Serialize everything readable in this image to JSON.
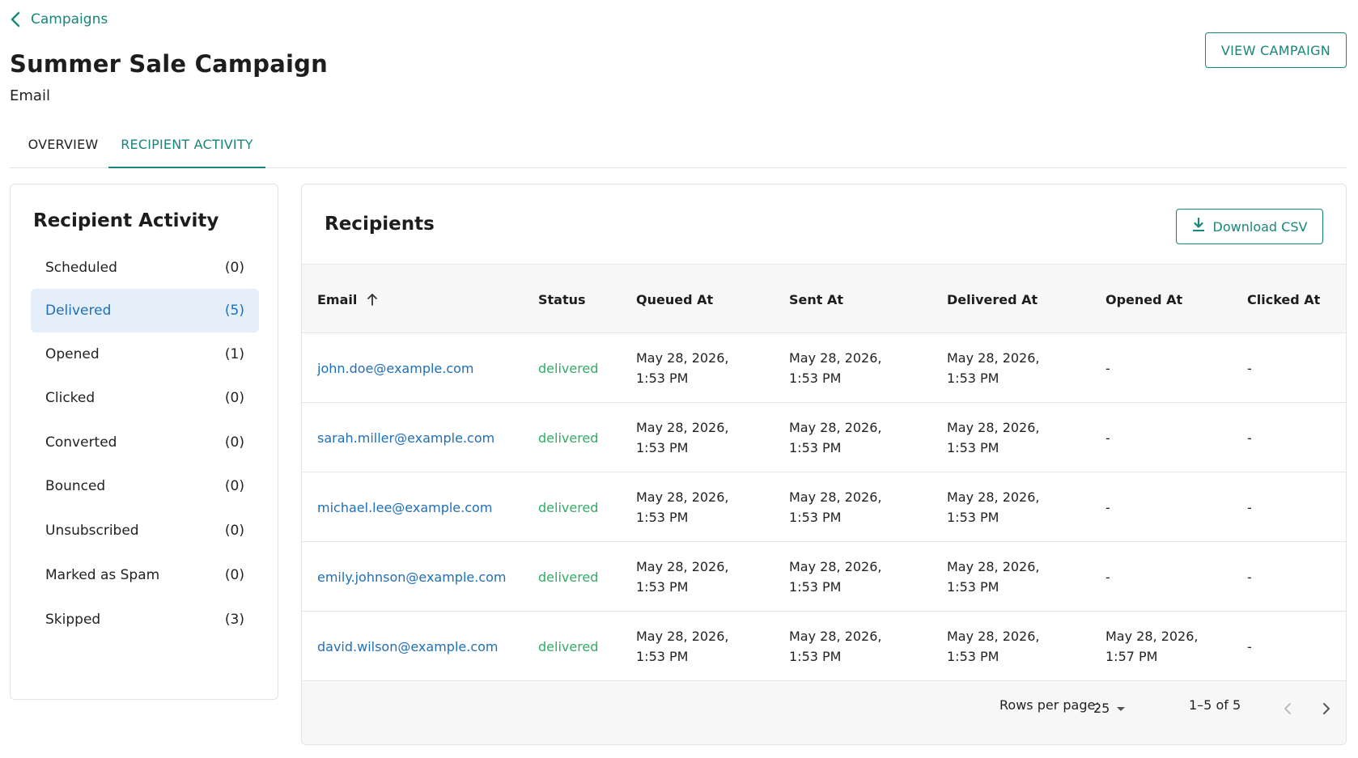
{
  "breadcrumb": {
    "back_label": "Campaigns"
  },
  "header": {
    "title": "Summer Sale Campaign",
    "subtitle": "Email",
    "view_campaign_label": "VIEW CAMPAIGN"
  },
  "tabs": [
    {
      "label": "OVERVIEW",
      "active": false
    },
    {
      "label": "RECIPIENT ACTIVITY",
      "active": true
    }
  ],
  "sidebar": {
    "title": "Recipient Activity",
    "items": [
      {
        "label": "Scheduled",
        "count": "(0)",
        "active": false
      },
      {
        "label": "Delivered",
        "count": "(5)",
        "active": true
      },
      {
        "label": "Opened",
        "count": "(1)",
        "active": false
      },
      {
        "label": "Clicked",
        "count": "(0)",
        "active": false
      },
      {
        "label": "Converted",
        "count": "(0)",
        "active": false
      },
      {
        "label": "Bounced",
        "count": "(0)",
        "active": false
      },
      {
        "label": "Unsubscribed",
        "count": "(0)",
        "active": false
      },
      {
        "label": "Marked as Spam",
        "count": "(0)",
        "active": false
      },
      {
        "label": "Skipped",
        "count": "(3)",
        "active": false
      }
    ]
  },
  "main": {
    "title": "Recipients",
    "download_label": "Download CSV",
    "columns": [
      "Email",
      "Status",
      "Queued At",
      "Sent At",
      "Delivered At",
      "Opened At",
      "Clicked At"
    ],
    "sort": {
      "column": "Email",
      "direction": "ascending"
    },
    "rows": [
      {
        "email": "john.doe@example.com",
        "status": "delivered",
        "queued": "May 28, 2026, 1:53 PM",
        "sent": "May 28, 2026, 1:53 PM",
        "delivered": "May 28, 2026, 1:53 PM",
        "opened": "-",
        "clicked": "-"
      },
      {
        "email": "sarah.miller@example.com",
        "status": "delivered",
        "queued": "May 28, 2026, 1:53 PM",
        "sent": "May 28, 2026, 1:53 PM",
        "delivered": "May 28, 2026, 1:53 PM",
        "opened": "-",
        "clicked": "-"
      },
      {
        "email": "michael.lee@example.com",
        "status": "delivered",
        "queued": "May 28, 2026, 1:53 PM",
        "sent": "May 28, 2026, 1:53 PM",
        "delivered": "May 28, 2026, 1:53 PM",
        "opened": "-",
        "clicked": "-"
      },
      {
        "email": "emily.johnson@example.com",
        "status": "delivered",
        "queued": "May 28, 2026, 1:53 PM",
        "sent": "May 28, 2026, 1:53 PM",
        "delivered": "May 28, 2026, 1:53 PM",
        "opened": "-",
        "clicked": "-"
      },
      {
        "email": "david.wilson@example.com",
        "status": "delivered",
        "queued": "May 28, 2026, 1:53 PM",
        "sent": "May 28, 2026, 1:53 PM",
        "delivered": "May 28, 2026, 1:53 PM",
        "opened": "May 28, 2026, 1:57 PM",
        "clicked": "-"
      }
    ],
    "pagination": {
      "rows_per_page_label": "Rows per page:",
      "rows_per_page_value": "25",
      "range_label": "1–5 of 5"
    }
  },
  "icons": {
    "back": "chevron-left-icon",
    "sort": "arrow-up-icon",
    "download": "download-icon",
    "dropdown": "caret-down-icon",
    "prev": "chevron-left-icon",
    "next": "chevron-right-icon"
  },
  "colors": {
    "accent": "#17877a",
    "link": "#1f6fb8",
    "status_delivered": "#2fae66",
    "active_item_bg": "#e4eff9"
  }
}
